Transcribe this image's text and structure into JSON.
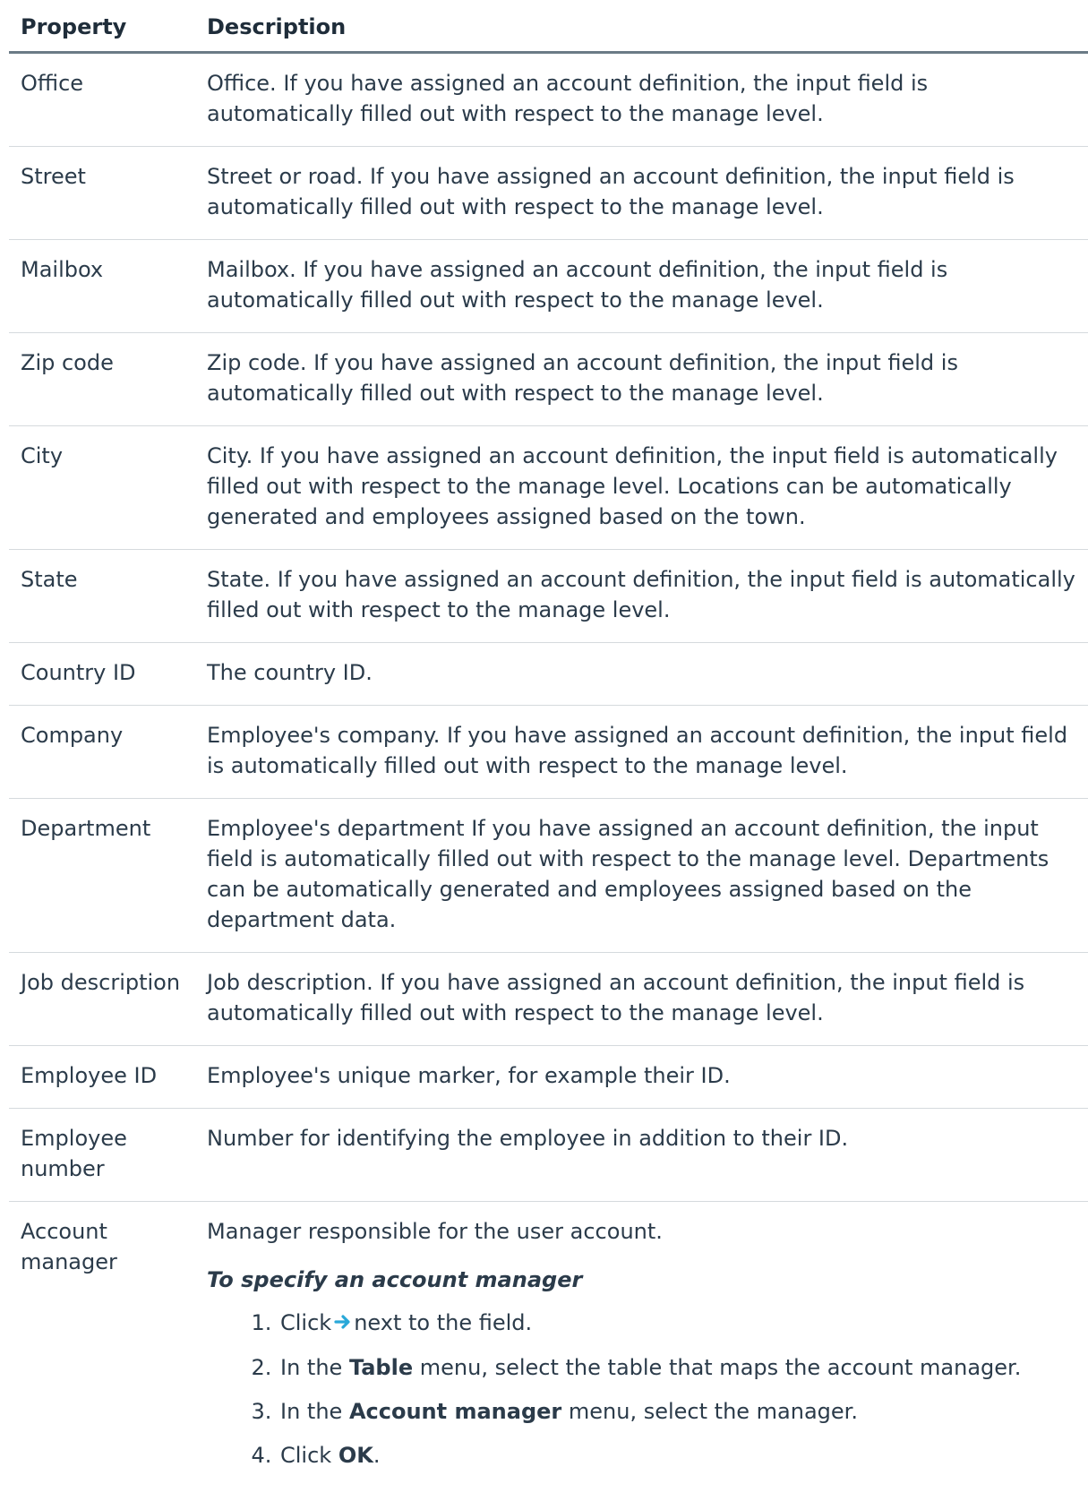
{
  "table": {
    "header": {
      "property": "Property",
      "description": "Description"
    },
    "rows": [
      {
        "property": "Office",
        "description": "Office. If you have assigned an account definition, the input field is automatically filled out with respect to the manage level."
      },
      {
        "property": "Street",
        "description": "Street or road. If you have assigned an account definition, the input field is automatically filled out with respect to the manage level."
      },
      {
        "property": "Mailbox",
        "description": "Mailbox. If you have assigned an account definition, the input field is automatically filled out with respect to the manage level."
      },
      {
        "property": "Zip code",
        "description": "Zip code. If you have assigned an account definition, the input field is automatically filled out with respect to the manage level."
      },
      {
        "property": "City",
        "description": "City. If you have assigned an account definition, the input field is automatically filled out with respect to the manage level. Locations can be automatically generated and employees assigned based on the town."
      },
      {
        "property": "State",
        "description": "State. If you have assigned an account definition, the input field is automatically filled out with respect to the manage level."
      },
      {
        "property": "Country ID",
        "description": "The country ID."
      },
      {
        "property": "Company",
        "description": "Employee's company. If you have assigned an account definition, the input field is automatically filled out with respect to the manage level."
      },
      {
        "property": "Department",
        "description": "Employee's department If you have assigned an account definition, the input field is automatically filled out with respect to the manage level. Departments can be automatically generated and employees assigned based on the department data."
      },
      {
        "property": "Job description",
        "description": "Job description. If you have assigned an account definition, the input field is automatically filled out with respect to the manage level."
      },
      {
        "property": "Employee ID",
        "description": "Employee's unique marker, for example their ID."
      },
      {
        "property": "Employee number",
        "description": "Number for identifying the employee in addition to their ID."
      }
    ],
    "account_manager": {
      "property": "Account manager",
      "description": "Manager responsible for the user account.",
      "procedure_title": "To specify an account manager",
      "step1": {
        "before": "Click",
        "icon": "right-arrow-icon",
        "icon_color": "#29a8d8",
        "after": "next to the field."
      },
      "step2": {
        "before": "In the",
        "bold": "Table",
        "after": "menu, select the table that maps the account manager."
      },
      "step3": {
        "before": "In the",
        "bold": "Account manager",
        "after": "menu, select the manager."
      },
      "step4": {
        "before": "Click",
        "bold": "OK",
        "after": "."
      }
    }
  }
}
